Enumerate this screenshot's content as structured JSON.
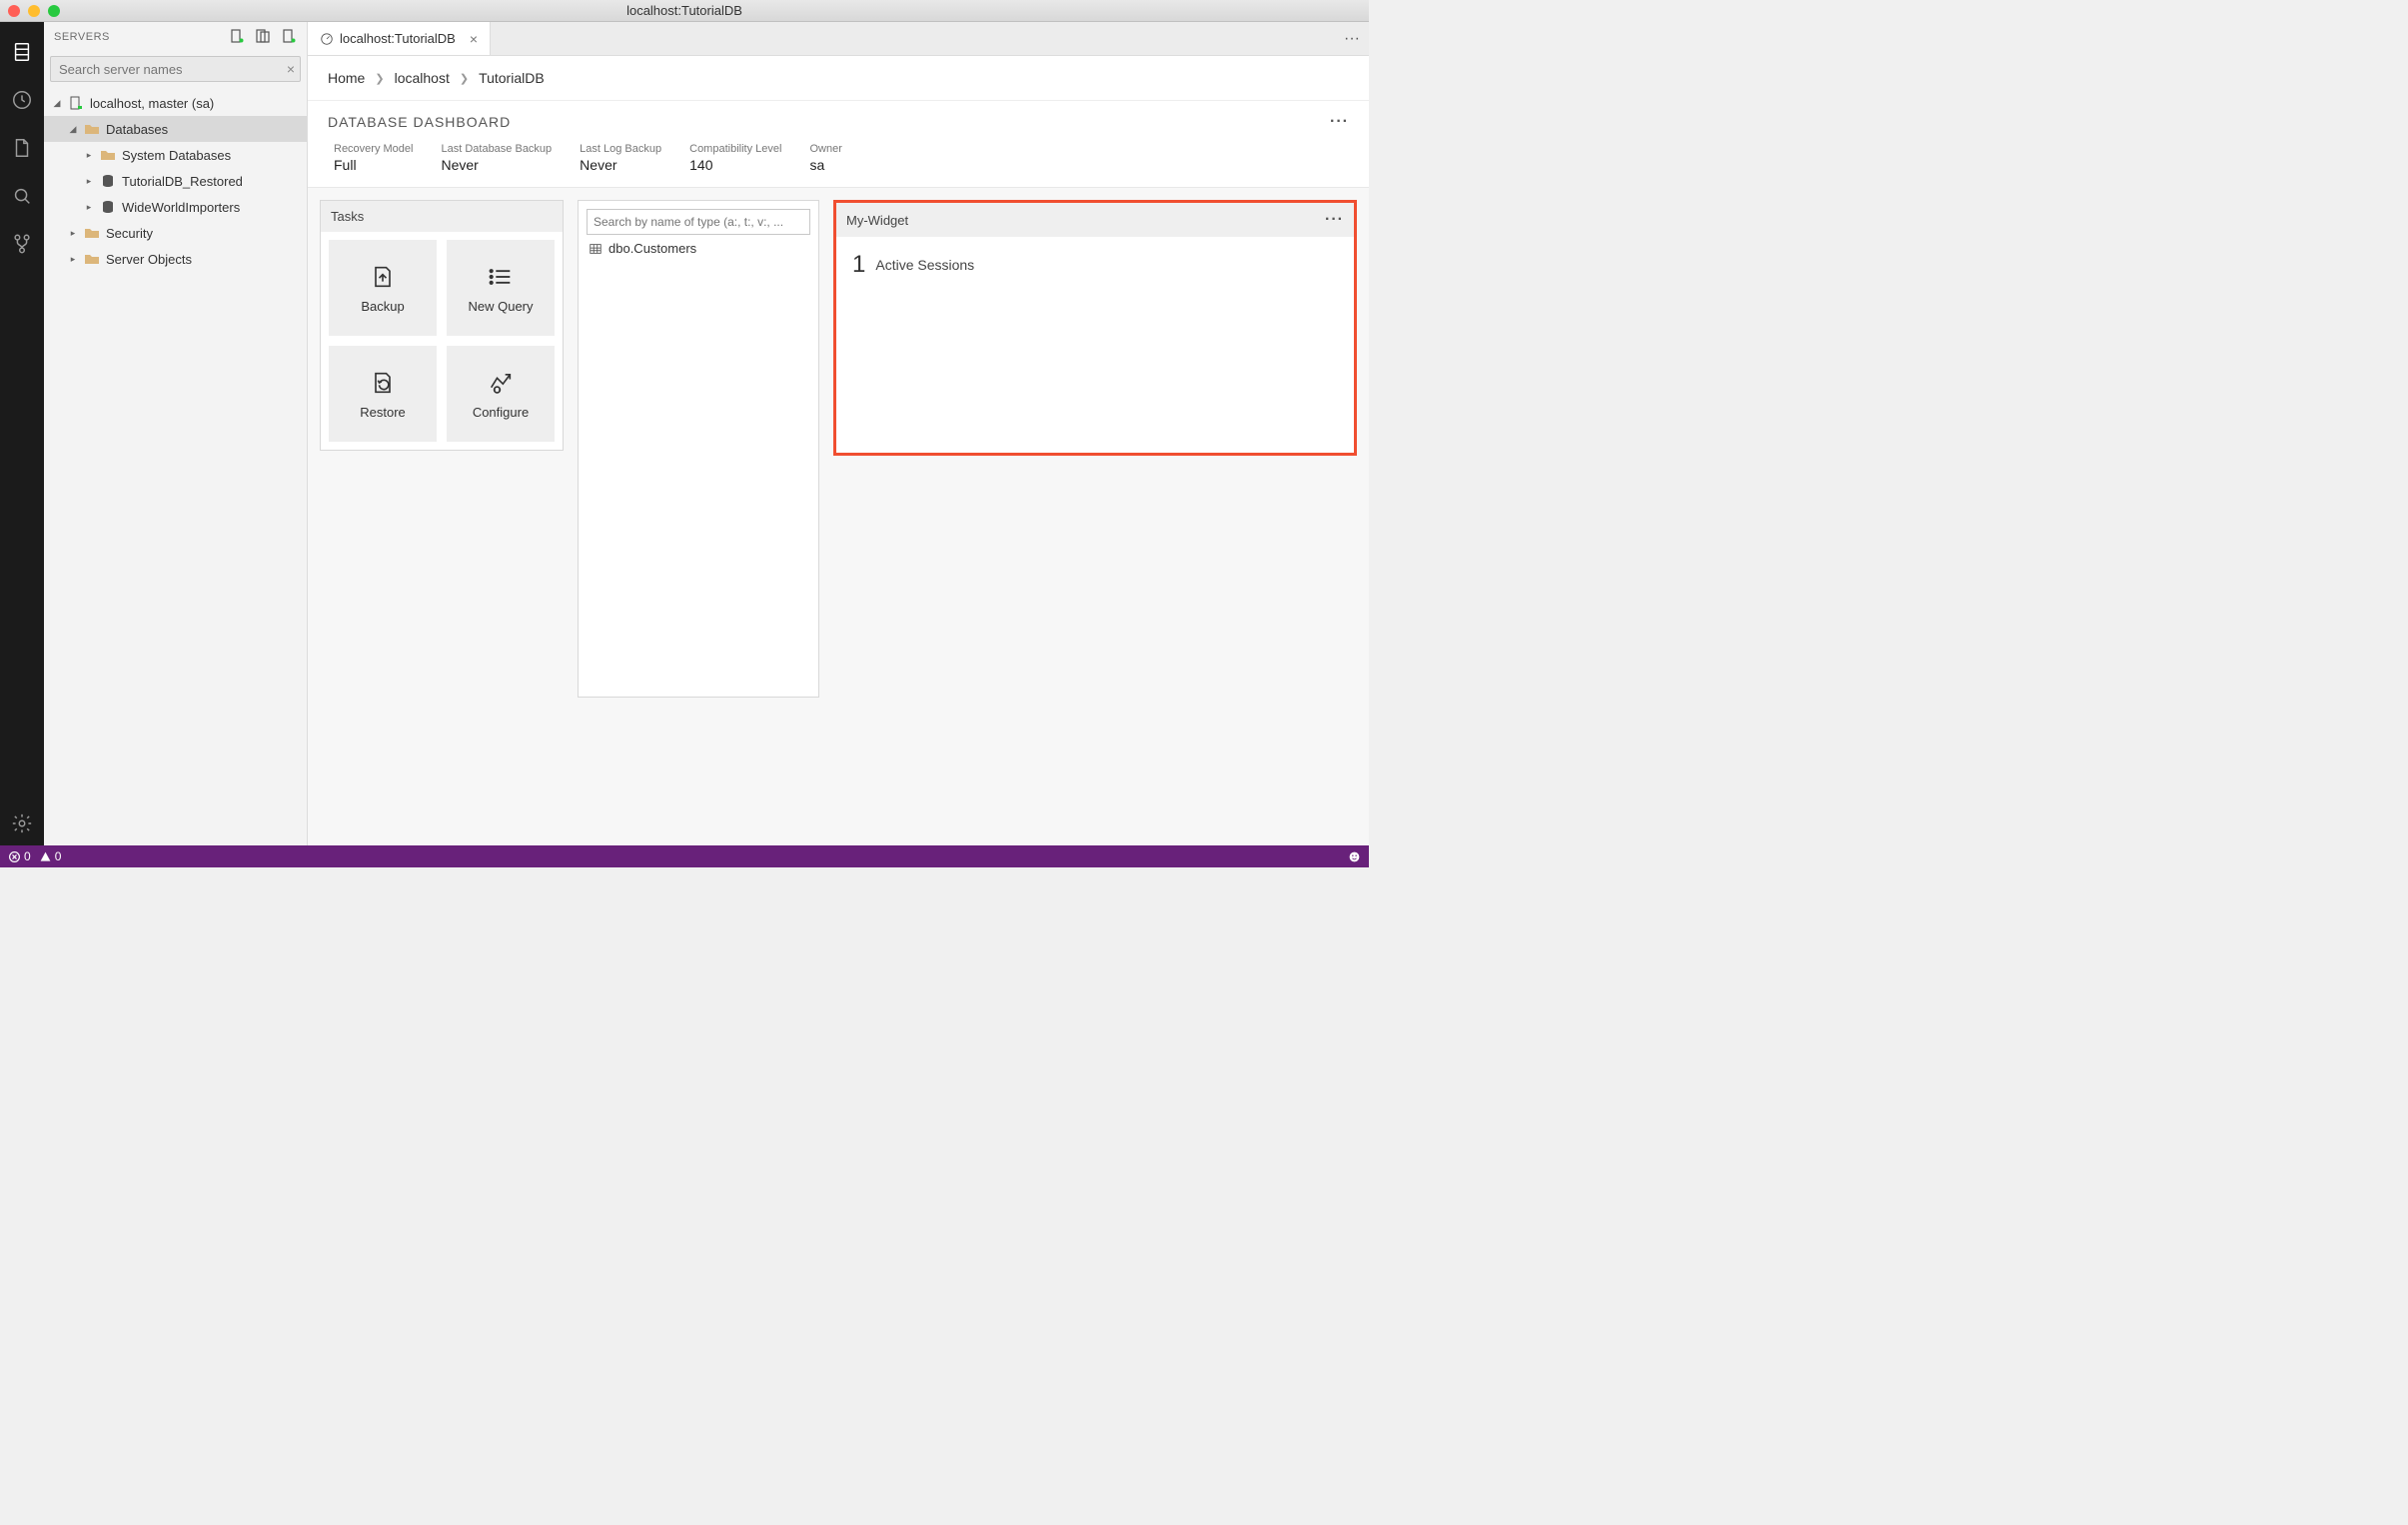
{
  "window": {
    "title": "localhost:TutorialDB"
  },
  "sidebar": {
    "title": "SERVERS",
    "search_placeholder": "Search server names",
    "tree": {
      "server": "localhost, master (sa)",
      "databases_label": "Databases",
      "children": [
        "System Databases",
        "TutorialDB_Restored",
        "WideWorldImporters"
      ],
      "security_label": "Security",
      "server_objects_label": "Server Objects"
    }
  },
  "tab": {
    "title": "localhost:TutorialDB"
  },
  "breadcrumbs": {
    "home": "Home",
    "server": "localhost",
    "db": "TutorialDB"
  },
  "dashboard": {
    "title": "DATABASE DASHBOARD",
    "props": [
      {
        "label": "Recovery Model",
        "value": "Full"
      },
      {
        "label": "Last Database Backup",
        "value": "Never"
      },
      {
        "label": "Last Log Backup",
        "value": "Never"
      },
      {
        "label": "Compatibility Level",
        "value": "140"
      },
      {
        "label": "Owner",
        "value": "sa"
      }
    ]
  },
  "tasks": {
    "title": "Tasks",
    "items": [
      "Backup",
      "New Query",
      "Restore",
      "Configure"
    ]
  },
  "object_search": {
    "placeholder": "Search by name of type (a:, t:, v:, ...",
    "results": [
      "dbo.Customers"
    ]
  },
  "widget": {
    "title": "My-Widget",
    "count": "1",
    "label": "Active Sessions"
  },
  "statusbar": {
    "errors": "0",
    "warnings": "0"
  }
}
